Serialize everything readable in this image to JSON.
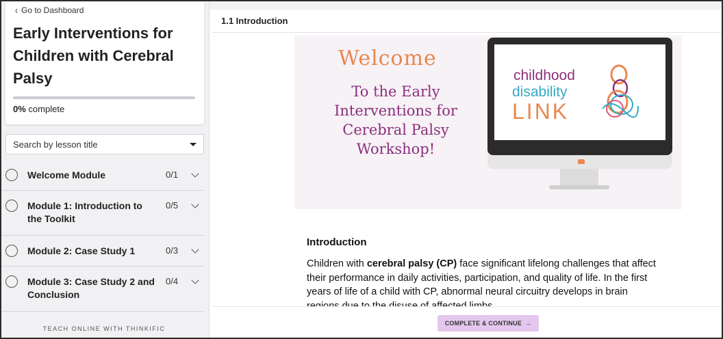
{
  "sidebar": {
    "back_link": "Go to Dashboard",
    "course_title": "Early Interventions for Children with Cerebral Palsy",
    "progress": {
      "percent_label": "0%",
      "suffix": "complete",
      "value": 0
    },
    "search_placeholder": "Search by lesson title",
    "modules": [
      {
        "name": "Welcome Module",
        "count": "0/1"
      },
      {
        "name": "Module 1: Introduction to the Toolkit",
        "count": "0/5"
      },
      {
        "name": "Module 2: Case Study 1",
        "count": "0/3"
      },
      {
        "name": "Module 3: Case Study 2 and Conclusion",
        "count": "0/4"
      }
    ],
    "footer": "TEACH ONLINE WITH THINKIFIC"
  },
  "main": {
    "lesson_title": "1.1 Introduction",
    "banner": {
      "welcome": "Welcome",
      "tagline": "To the Early Interventions for Cerebral Palsy Workshop!",
      "logo_line1": "childhood",
      "logo_line2": "disability",
      "logo_line3": "LINK"
    },
    "intro_heading": "Introduction",
    "intro_text": {
      "part1": "Children with ",
      "bold": "cerebral palsy (CP)",
      "part2": " face significant lifelong challenges that affect their performance in daily activities, participation, and quality of life. In the first years of life of a child with CP, abnormal neural circuitry develops in brain regions due to the disuse of affected limbs."
    },
    "complete_button": "COMPLETE & CONTINUE",
    "complete_arrow": "→"
  },
  "colors": {
    "accent_orange": "#e8884f",
    "accent_purple": "#8b2f7d",
    "accent_teal": "#35a9c5",
    "button_bg": "#e4c7ee",
    "progress_fill": "#6a6fb5"
  }
}
